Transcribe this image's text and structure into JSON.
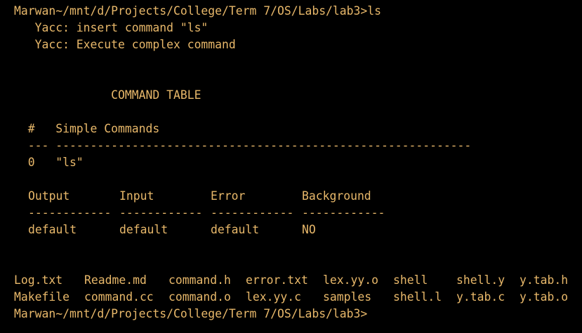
{
  "terminal": {
    "prompt_top": "Marwan~/mnt/d/Projects/College/Term 7/OS/Labs/lab3>ls",
    "yacc_line_1": "   Yacc: insert command \"ls\"",
    "yacc_line_2": "   Yacc: Execute complex command",
    "table_title": "              COMMAND TABLE",
    "header_simple": "  #   Simple Commands",
    "divider_simple": "  --- ------------------------------------------------------------",
    "row_simple": "  0   \"ls\"",
    "io_headers": [
      "Output",
      "Input",
      "Error",
      "Background"
    ],
    "io_dividers": [
      "------------",
      "------------",
      "------------",
      "------------"
    ],
    "io_values": [
      "default",
      "default",
      "default",
      "NO"
    ],
    "ls_row_1": [
      "Log.txt",
      "Readme.md",
      "command.h",
      "error.txt",
      "lex.yy.o",
      "shell",
      "shell.y",
      "y.tab.h"
    ],
    "ls_row_2": [
      "Makefile",
      "command.cc",
      "command.o",
      "lex.yy.c",
      "samples",
      "shell.l",
      "y.tab.c",
      "y.tab.o"
    ],
    "prompt_bottom": "Marwan~/mnt/d/Projects/College/Term 7/OS/Labs/lab3>"
  },
  "colors": {
    "background": "#000000",
    "foreground": "#e8b86a"
  }
}
